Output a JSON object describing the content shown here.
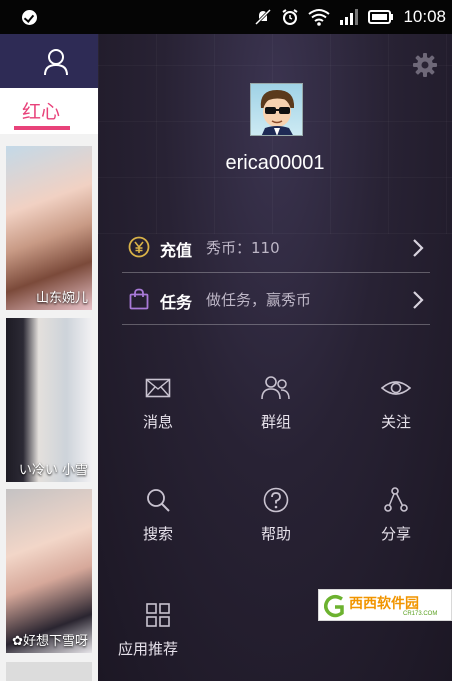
{
  "status_bar": {
    "time": "10:08",
    "icons": [
      "check-circle-icon",
      "mute-icon",
      "alarm-icon",
      "wifi-icon",
      "signal-icon",
      "battery-icon"
    ]
  },
  "background_app": {
    "active_tab": "红心",
    "thumbnails": [
      {
        "caption": "山东婉儿"
      },
      {
        "caption": "い冷い 小雪"
      },
      {
        "caption": "✿好想下雪呀"
      }
    ],
    "accent_color": "#e8427a"
  },
  "drawer": {
    "username": "erica00001",
    "recharge": {
      "title": "充值",
      "subtitle": "秀币：110"
    },
    "task": {
      "title": "任务",
      "subtitle": "做任务，赢秀币"
    },
    "grid": {
      "messages": "消息",
      "groups": "群组",
      "follow": "关注",
      "search": "搜索",
      "help": "帮助",
      "share": "分享",
      "app_recommend": "应用推荐"
    }
  },
  "watermark": {
    "logo": "西西软件园",
    "sub": "CR173.COM"
  }
}
